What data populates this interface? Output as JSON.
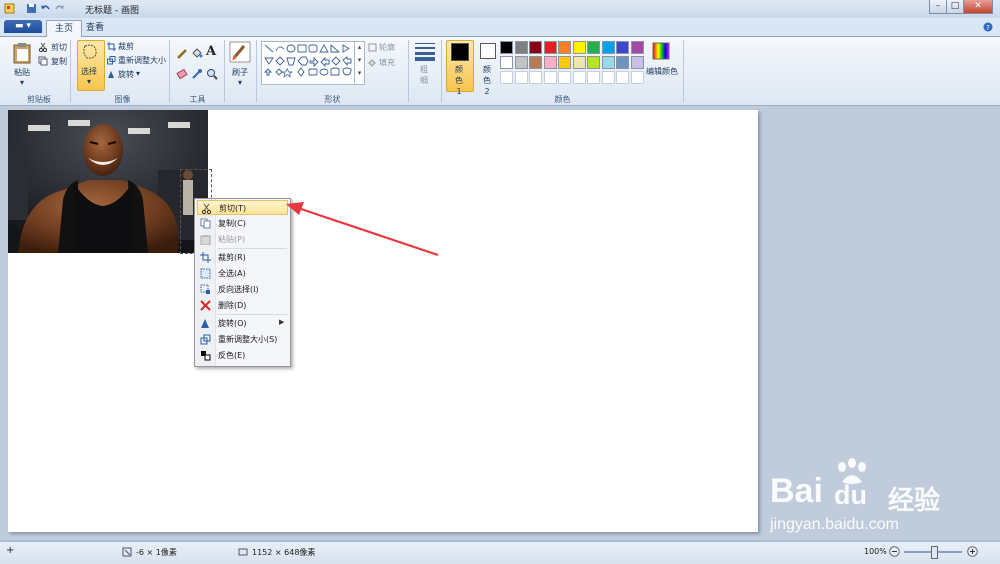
{
  "window": {
    "title": "无标题 - 画图",
    "controls": [
      "–",
      "□",
      "✕"
    ]
  },
  "tabs": [
    {
      "label": "主页"
    },
    {
      "label": "查看"
    }
  ],
  "ribbon": {
    "clipboard": {
      "paste_label": "粘贴",
      "cut_label": "剪切",
      "copy_label": "复制",
      "group_label": "剪贴板"
    },
    "image": {
      "select_label": "选择",
      "crop_label": "裁剪",
      "resize_label": "重新调整大小",
      "rotate_label": "旋转",
      "group_label": "图像"
    },
    "tools": {
      "group_label": "工具",
      "text_tool": "A"
    },
    "brushes": {
      "label": "刷子"
    },
    "shapes": {
      "outline_label": "轮廓",
      "fill_label": "填充",
      "group_label": "形状"
    },
    "size": {
      "label": "粗细"
    },
    "colors": {
      "color1_label": "颜色 1",
      "color2_label": "颜色 2",
      "edit_colors_label": "编辑颜色",
      "group_label": "颜色",
      "color1": "#000000",
      "color2": "#ffffff",
      "palette_row1": [
        "#000000",
        "#7f7f7f",
        "#880015",
        "#ed1c24",
        "#ff7f27",
        "#fff200",
        "#22b14c",
        "#00a2e8",
        "#3f48cc",
        "#a349a4"
      ],
      "palette_row2": [
        "#ffffff",
        "#c3c3c3",
        "#b97a57",
        "#ffaec9",
        "#ffc90e",
        "#efe4b0",
        "#b5e61d",
        "#99d9ea",
        "#7092be",
        "#c8bfe7"
      ]
    }
  },
  "context_menu": [
    {
      "label": "剪切(T)",
      "icon": "scissors-icon",
      "highlighted": true,
      "disabled": false
    },
    {
      "label": "复制(C)",
      "icon": "copy-icon",
      "highlighted": false,
      "disabled": false
    },
    {
      "label": "粘贴(P)",
      "icon": "paste-icon",
      "highlighted": false,
      "disabled": true
    },
    {
      "label": "裁剪(R)",
      "icon": "crop-icon",
      "highlighted": false,
      "disabled": false
    },
    {
      "label": "全选(A)",
      "icon": "select-all-icon",
      "highlighted": false,
      "disabled": false
    },
    {
      "label": "反向选择(I)",
      "icon": "invert-selection-icon",
      "highlighted": false,
      "disabled": false
    },
    {
      "label": "删除(D)",
      "icon": "delete-icon",
      "highlighted": false,
      "disabled": false
    },
    {
      "label": "旋转(O)",
      "icon": "rotate-icon",
      "highlighted": false,
      "disabled": false,
      "submenu": true
    },
    {
      "label": "重新调整大小(S)",
      "icon": "resize-icon",
      "highlighted": false,
      "disabled": false
    },
    {
      "label": "反色(E)",
      "icon": "invert-color-icon",
      "highlighted": false,
      "disabled": false
    }
  ],
  "status": {
    "cursor_pos": "-6 × 1像素",
    "image_size": "1152 × 648像素",
    "zoom": "100%"
  },
  "watermark": {
    "brand": "Bai",
    "brand2": "经验",
    "url": "jingyan.baidu.com"
  },
  "colors": {
    "arrow": "#e8383d",
    "accent": "#1f4d99"
  }
}
